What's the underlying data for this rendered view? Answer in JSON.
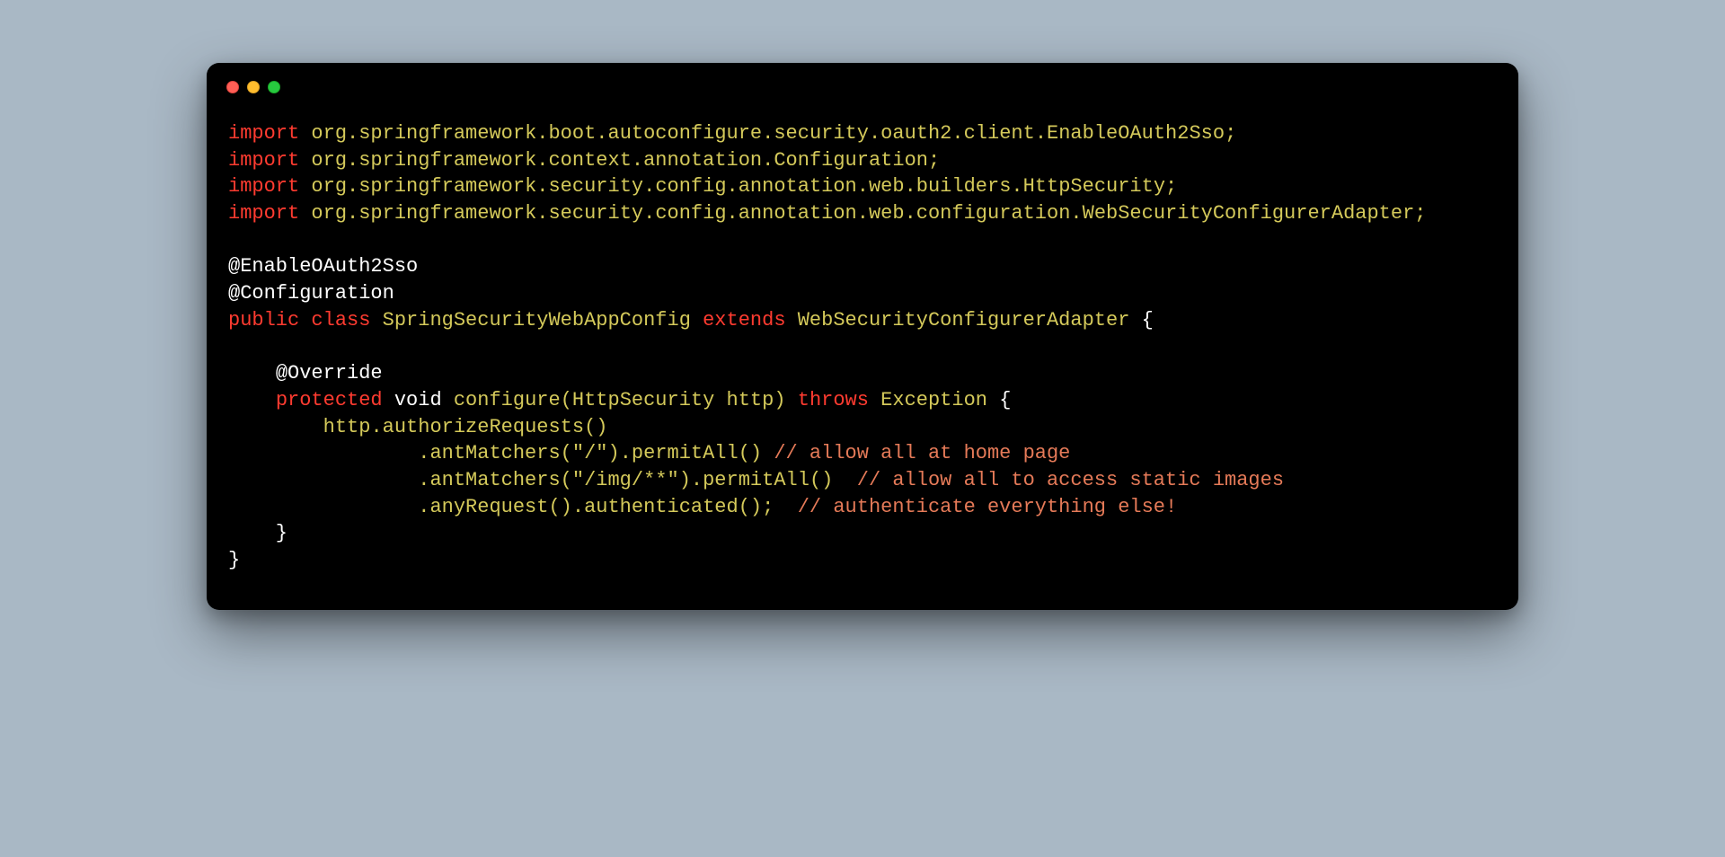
{
  "colors": {
    "background": "#a9b8c5",
    "window_bg": "#000000",
    "keyword": "#ff3b30",
    "identifier": "#d4c95a",
    "comment": "#e57a58",
    "text": "#ffffff",
    "traffic_red": "#ff5f56",
    "traffic_yellow": "#ffbd2e",
    "traffic_green": "#27c93f"
  },
  "code": {
    "lines": [
      [
        {
          "c": "kw",
          "t": "import"
        },
        {
          "c": "plain",
          "t": " "
        },
        {
          "c": "pkg",
          "t": "org"
        },
        {
          "c": "punct",
          "t": "."
        },
        {
          "c": "pkg",
          "t": "springframework"
        },
        {
          "c": "punct",
          "t": "."
        },
        {
          "c": "pkg",
          "t": "boot"
        },
        {
          "c": "punct",
          "t": "."
        },
        {
          "c": "pkg",
          "t": "autoconfigure"
        },
        {
          "c": "punct",
          "t": "."
        },
        {
          "c": "pkg",
          "t": "security"
        },
        {
          "c": "punct",
          "t": "."
        },
        {
          "c": "pkg",
          "t": "oauth2"
        },
        {
          "c": "punct",
          "t": "."
        },
        {
          "c": "pkg",
          "t": "client"
        },
        {
          "c": "punct",
          "t": "."
        },
        {
          "c": "pkg",
          "t": "EnableOAuth2Sso"
        },
        {
          "c": "punct",
          "t": ";"
        }
      ],
      [
        {
          "c": "kw",
          "t": "import"
        },
        {
          "c": "plain",
          "t": " "
        },
        {
          "c": "pkg",
          "t": "org"
        },
        {
          "c": "punct",
          "t": "."
        },
        {
          "c": "pkg",
          "t": "springframework"
        },
        {
          "c": "punct",
          "t": "."
        },
        {
          "c": "pkg",
          "t": "context"
        },
        {
          "c": "punct",
          "t": "."
        },
        {
          "c": "pkg",
          "t": "annotation"
        },
        {
          "c": "punct",
          "t": "."
        },
        {
          "c": "pkg",
          "t": "Configuration"
        },
        {
          "c": "punct",
          "t": ";"
        }
      ],
      [
        {
          "c": "kw",
          "t": "import"
        },
        {
          "c": "plain",
          "t": " "
        },
        {
          "c": "pkg",
          "t": "org"
        },
        {
          "c": "punct",
          "t": "."
        },
        {
          "c": "pkg",
          "t": "springframework"
        },
        {
          "c": "punct",
          "t": "."
        },
        {
          "c": "pkg",
          "t": "security"
        },
        {
          "c": "punct",
          "t": "."
        },
        {
          "c": "pkg",
          "t": "config"
        },
        {
          "c": "punct",
          "t": "."
        },
        {
          "c": "pkg",
          "t": "annotation"
        },
        {
          "c": "punct",
          "t": "."
        },
        {
          "c": "pkg",
          "t": "web"
        },
        {
          "c": "punct",
          "t": "."
        },
        {
          "c": "pkg",
          "t": "builders"
        },
        {
          "c": "punct",
          "t": "."
        },
        {
          "c": "pkg",
          "t": "HttpSecurity"
        },
        {
          "c": "punct",
          "t": ";"
        }
      ],
      [
        {
          "c": "kw",
          "t": "import"
        },
        {
          "c": "plain",
          "t": " "
        },
        {
          "c": "pkg",
          "t": "org"
        },
        {
          "c": "punct",
          "t": "."
        },
        {
          "c": "pkg",
          "t": "springframework"
        },
        {
          "c": "punct",
          "t": "."
        },
        {
          "c": "pkg",
          "t": "security"
        },
        {
          "c": "punct",
          "t": "."
        },
        {
          "c": "pkg",
          "t": "config"
        },
        {
          "c": "punct",
          "t": "."
        },
        {
          "c": "pkg",
          "t": "annotation"
        },
        {
          "c": "punct",
          "t": "."
        },
        {
          "c": "pkg",
          "t": "web"
        },
        {
          "c": "punct",
          "t": "."
        },
        {
          "c": "pkg",
          "t": "configuration"
        },
        {
          "c": "punct",
          "t": "."
        },
        {
          "c": "pkg",
          "t": "WebSecurityConfigurerAdapter"
        },
        {
          "c": "punct",
          "t": ";"
        }
      ],
      [],
      [
        {
          "c": "ann",
          "t": "@EnableOAuth2Sso"
        }
      ],
      [
        {
          "c": "ann",
          "t": "@Configuration"
        }
      ],
      [
        {
          "c": "kw",
          "t": "public"
        },
        {
          "c": "plain",
          "t": " "
        },
        {
          "c": "kw",
          "t": "class"
        },
        {
          "c": "plain",
          "t": " "
        },
        {
          "c": "type",
          "t": "SpringSecurityWebAppConfig"
        },
        {
          "c": "plain",
          "t": " "
        },
        {
          "c": "kw",
          "t": "extends"
        },
        {
          "c": "plain",
          "t": " "
        },
        {
          "c": "type",
          "t": "WebSecurityConfigurerAdapter"
        },
        {
          "c": "plain",
          "t": " "
        },
        {
          "c": "plain",
          "t": "{"
        }
      ],
      [],
      [
        {
          "c": "plain",
          "t": "    "
        },
        {
          "c": "ann",
          "t": "@Override"
        }
      ],
      [
        {
          "c": "plain",
          "t": "    "
        },
        {
          "c": "kw",
          "t": "protected"
        },
        {
          "c": "plain",
          "t": " "
        },
        {
          "c": "voidkw",
          "t": "void"
        },
        {
          "c": "plain",
          "t": " "
        },
        {
          "c": "method",
          "t": "configure"
        },
        {
          "c": "punct",
          "t": "("
        },
        {
          "c": "type",
          "t": "HttpSecurity"
        },
        {
          "c": "plain",
          "t": " "
        },
        {
          "c": "pkg",
          "t": "http"
        },
        {
          "c": "punct",
          "t": ")"
        },
        {
          "c": "plain",
          "t": " "
        },
        {
          "c": "kw",
          "t": "throws"
        },
        {
          "c": "plain",
          "t": " "
        },
        {
          "c": "type",
          "t": "Exception"
        },
        {
          "c": "plain",
          "t": " "
        },
        {
          "c": "plain",
          "t": "{"
        }
      ],
      [
        {
          "c": "plain",
          "t": "        "
        },
        {
          "c": "pkg",
          "t": "http"
        },
        {
          "c": "punct",
          "t": "."
        },
        {
          "c": "method",
          "t": "authorizeRequests"
        },
        {
          "c": "punct",
          "t": "()"
        }
      ],
      [
        {
          "c": "plain",
          "t": "                "
        },
        {
          "c": "punct",
          "t": "."
        },
        {
          "c": "method",
          "t": "antMatchers"
        },
        {
          "c": "punct",
          "t": "("
        },
        {
          "c": "str",
          "t": "\"/\""
        },
        {
          "c": "punct",
          "t": ")"
        },
        {
          "c": "punct",
          "t": "."
        },
        {
          "c": "method",
          "t": "permitAll"
        },
        {
          "c": "punct",
          "t": "()"
        },
        {
          "c": "plain",
          "t": " "
        },
        {
          "c": "comment",
          "t": "// allow all at home page"
        }
      ],
      [
        {
          "c": "plain",
          "t": "                "
        },
        {
          "c": "punct",
          "t": "."
        },
        {
          "c": "method",
          "t": "antMatchers"
        },
        {
          "c": "punct",
          "t": "("
        },
        {
          "c": "str",
          "t": "\"/img/**\""
        },
        {
          "c": "punct",
          "t": ")"
        },
        {
          "c": "punct",
          "t": "."
        },
        {
          "c": "method",
          "t": "permitAll"
        },
        {
          "c": "punct",
          "t": "()"
        },
        {
          "c": "plain",
          "t": "  "
        },
        {
          "c": "comment",
          "t": "// allow all to access static images"
        }
      ],
      [
        {
          "c": "plain",
          "t": "                "
        },
        {
          "c": "punct",
          "t": "."
        },
        {
          "c": "method",
          "t": "anyRequest"
        },
        {
          "c": "punct",
          "t": "()"
        },
        {
          "c": "punct",
          "t": "."
        },
        {
          "c": "method",
          "t": "authenticated"
        },
        {
          "c": "punct",
          "t": "();"
        },
        {
          "c": "plain",
          "t": "  "
        },
        {
          "c": "comment",
          "t": "// authenticate everything else!"
        }
      ],
      [
        {
          "c": "plain",
          "t": "    }"
        }
      ],
      [
        {
          "c": "plain",
          "t": "}"
        }
      ]
    ]
  }
}
